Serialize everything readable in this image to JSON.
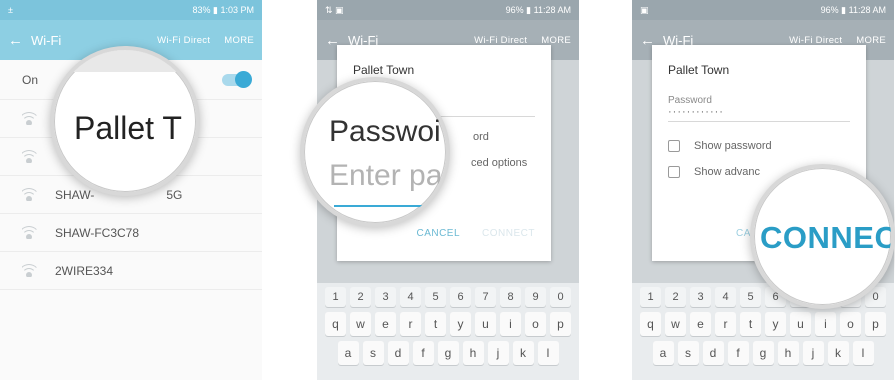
{
  "panel1": {
    "status": {
      "left": "±",
      "right": "83% ▮ 1:03 PM"
    },
    "appbar": {
      "back": "←",
      "title": "Wi-Fi",
      "action1": "Wi-Fi Direct",
      "action2": "MORE"
    },
    "on_label": "On",
    "networks": [
      {
        "name": ""
      },
      {
        "name": ""
      },
      {
        "name": "SHAW-"
      },
      {
        "name": "SHAW-FC3C78"
      },
      {
        "name": "2WIRE334"
      }
    ],
    "network3_suffix": "5G",
    "magnifier_text": "Pallet T"
  },
  "panel2": {
    "status": {
      "left": "⇅ ▣",
      "right": "96% ▮ 11:28 AM"
    },
    "appbar": {
      "back": "←",
      "title": "Wi-Fi",
      "action1": "Wi-Fi Direct",
      "action2": "MORE"
    },
    "dialog": {
      "title": "Pallet Town",
      "show_password_partial": "ord",
      "advanced_partial": "ced options",
      "cancel": "CANCEL",
      "connect": "CONNECT"
    },
    "magnifier": {
      "line1": "Passwoi",
      "line2": "Enter pa:"
    }
  },
  "panel3": {
    "status": {
      "left": "▣",
      "right": "96% ▮ 11:28 AM"
    },
    "appbar": {
      "back": "←",
      "title": "Wi-Fi",
      "action1": "Wi-Fi Direct",
      "action2": "MORE"
    },
    "dialog": {
      "title": "Pallet Town",
      "password_label": "Password",
      "password_value": "············",
      "show_password": "Show password",
      "show_advanced": "Show advanc",
      "cancel_partial": "CAN"
    },
    "magnifier_text": "CONNECT"
  },
  "keyboard": {
    "digits": [
      "1",
      "2",
      "3",
      "4",
      "5",
      "6",
      "7",
      "8",
      "9",
      "0"
    ],
    "row1": [
      "q",
      "w",
      "e",
      "r",
      "t",
      "y",
      "u",
      "i",
      "o",
      "p"
    ],
    "row2": [
      "a",
      "s",
      "d",
      "f",
      "g",
      "h",
      "j",
      "k",
      "l"
    ]
  }
}
